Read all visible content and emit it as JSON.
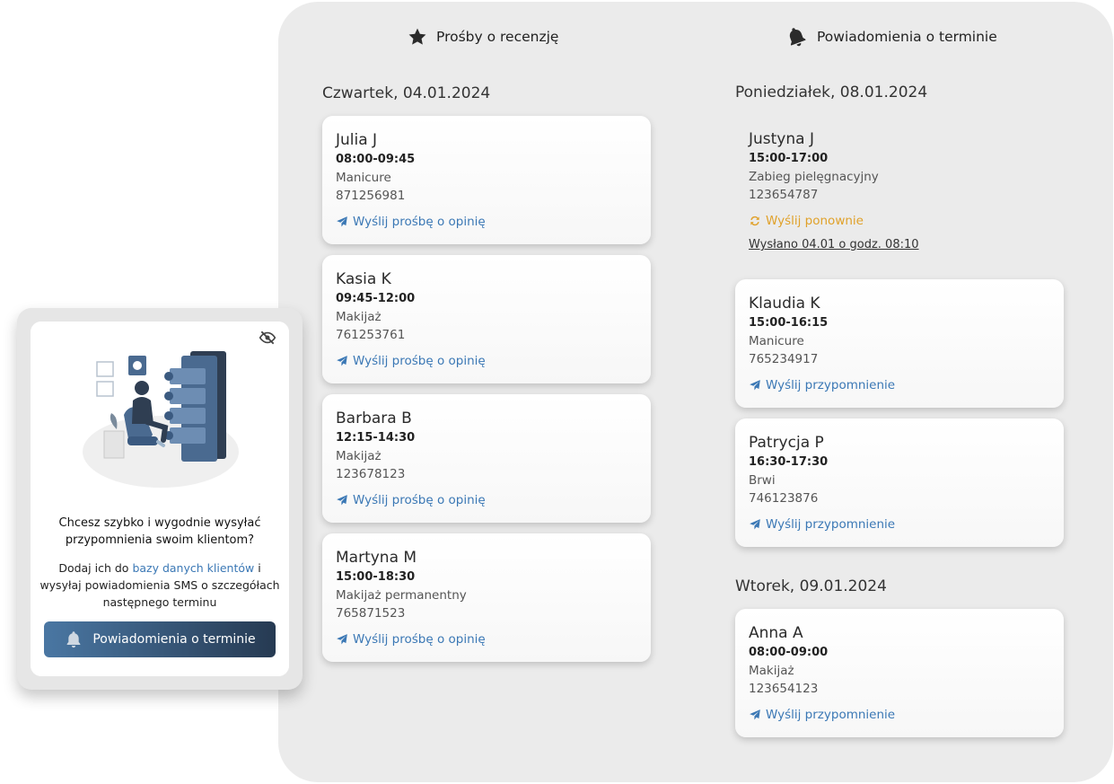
{
  "review_column": {
    "header": "Prośby o recenzję",
    "day": "Czwartek, 04.01.2024",
    "cards": [
      {
        "name": "Julia J",
        "time": "08:00-09:45",
        "service": "Manicure",
        "phone": "871256981",
        "action": "Wyślij prośbę o opinię"
      },
      {
        "name": "Kasia K",
        "time": "09:45-12:00",
        "service": "Makijaż",
        "phone": "761253761",
        "action": "Wyślij prośbę o opinię"
      },
      {
        "name": "Barbara B",
        "time": "12:15-14:30",
        "service": "Makijaż",
        "phone": "123678123",
        "action": "Wyślij prośbę o opinię"
      },
      {
        "name": "Martyna M",
        "time": "15:00-18:30",
        "service": "Makijaż permanentny",
        "phone": "765871523",
        "action": "Wyślij prośbę o opinię"
      }
    ]
  },
  "reminder_column": {
    "header": "Powiadomienia o terminie",
    "days": [
      {
        "title": "Poniedziałek, 08.01.2024",
        "cards": [
          {
            "name": "Justyna J",
            "time": "15:00-17:00",
            "service": "Zabieg pielęgnacyjny",
            "phone": "123654787",
            "action": "Wyślij ponownie",
            "sent_note": "Wysłano 04.01 o godz. 08:10"
          },
          {
            "name": "Klaudia K",
            "time": "15:00-16:15",
            "service": "Manicure",
            "phone": "765234917",
            "action": "Wyślij przypomnienie"
          },
          {
            "name": "Patrycja P",
            "time": "16:30-17:30",
            "service": "Brwi",
            "phone": "746123876",
            "action": "Wyślij przypomnienie"
          }
        ]
      },
      {
        "title": "Wtorek, 09.01.2024",
        "cards": [
          {
            "name": "Anna A",
            "time": "08:00-09:00",
            "service": "Makijaż",
            "phone": "123654123",
            "action": "Wyślij przypomnienie"
          }
        ]
      }
    ]
  },
  "promo": {
    "question": "Chcesz szybko i wygodnie wysyłać przypomnienia swoim klientom?",
    "desc_before": "Dodaj ich do ",
    "desc_link": "bazy danych klientów",
    "desc_after": " i wysyłaj powiadomienia SMS o szczegółach następnego terminu",
    "button": "Powiadomienia o terminie"
  },
  "colors": {
    "link_blue": "#3b78b5",
    "retry_orange": "#e0a12a",
    "panel_bg": "#ebebeb",
    "button_gradient_start": "#4a77a3",
    "button_gradient_end": "#263a52"
  }
}
